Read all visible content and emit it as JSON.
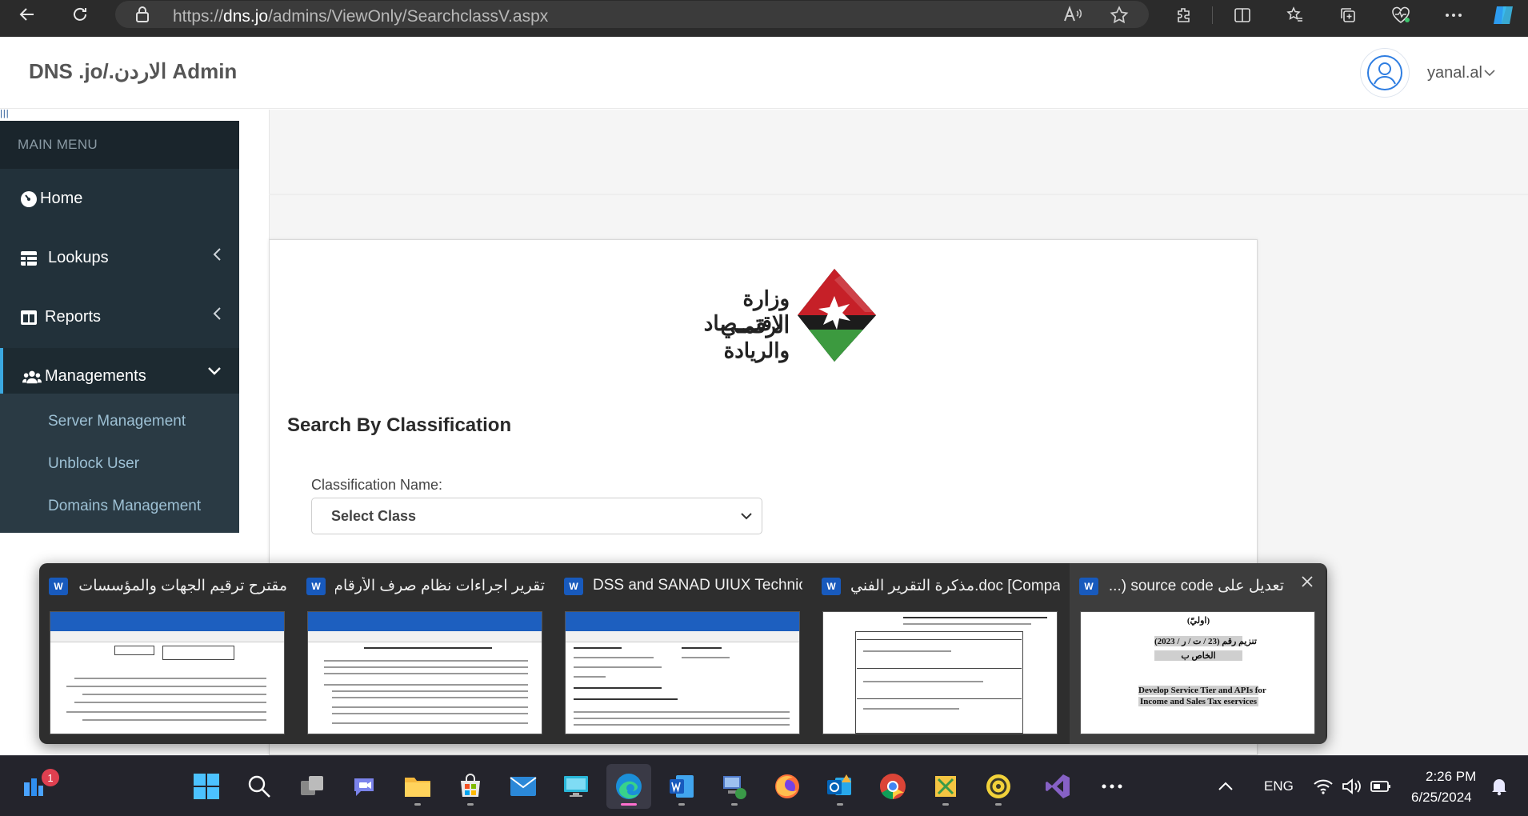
{
  "browser": {
    "url_prefix": "https://",
    "url_host": "dns.jo",
    "url_path": "/admins/ViewOnly/SearchclassV.aspx"
  },
  "header": {
    "brand": "DNS .jo/.الاردن Admin",
    "user_name": "yanal.al"
  },
  "sidebar": {
    "menu_header": "MAIN MENU",
    "items": [
      {
        "label": "Home",
        "icon": "dashboard-icon"
      },
      {
        "label": "Lookups",
        "icon": "table-icon"
      },
      {
        "label": "Reports",
        "icon": "columns-icon"
      },
      {
        "label": "Managements",
        "icon": "users-icon"
      }
    ],
    "submenu": [
      "Server Management",
      "Unblock User",
      "Domains Management"
    ]
  },
  "main": {
    "logo_line1": "وزارة الاقتـــصاد",
    "logo_line2": "الرقمـي والريادة",
    "title": "Search By Classification",
    "field_label": "Classification Name:",
    "select_value": "Select Class"
  },
  "taskbar_popup": {
    "windows": [
      {
        "title": "مقترح ترقيم الجهات والمؤسسات ..."
      },
      {
        "title": "تقرير اجراءات نظام صرف الأرقام ..."
      },
      {
        "title": "DSS and SANAD UIUX Technica..."
      },
      {
        "title": "مذكرة التقرير الفني.doc [Compa..."
      },
      {
        "title": "تعديل على source code (..."
      }
    ],
    "preview_texts": {
      "p5_line1": "(اوليّ)",
      "p5_line2": "تنزيم رقم (23 / ت / ر / 2023)",
      "p5_line3": "الخاص ب",
      "p5_line4": "Develop Service Tier and APIs for",
      "p5_line5": "Income and Sales Tax eservices"
    }
  },
  "tray": {
    "lang": "ENG",
    "time": "2:26 PM",
    "date": "6/25/2024",
    "notification_count": "1"
  },
  "colors": {
    "sidebar_bg": "#22313a",
    "sidebar_active_accent": "#3ba8e0",
    "submenu_text": "#9dc0d4",
    "taskbar_bg": "#24242c"
  }
}
